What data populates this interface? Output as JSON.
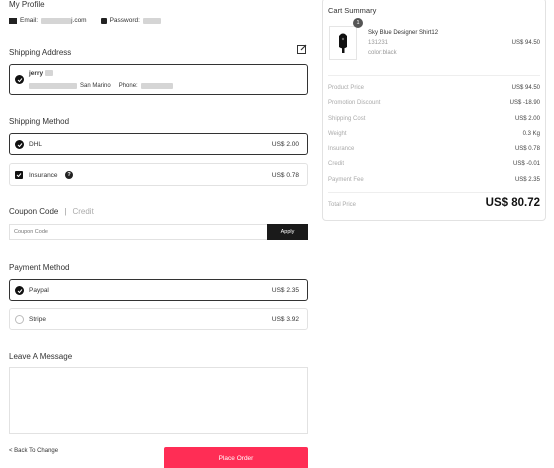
{
  "profile": {
    "title": "My Profile",
    "email_label": "Email:",
    "email_suffix": "j.com",
    "password_label": "Password:"
  },
  "shipping_address": {
    "title": "Shipping Address",
    "name": "jerry",
    "city": "San Marino",
    "phone_label": "Phone:"
  },
  "shipping_method": {
    "title": "Shipping Method",
    "options": [
      {
        "label": "DHL",
        "price": "US$ 2.00",
        "selected": true
      }
    ],
    "insurance_label": "Insurance",
    "insurance_price": "US$ 0.78"
  },
  "coupon": {
    "title": "Coupon Code",
    "divider": "|",
    "credit_tab": "Credit",
    "placeholder": "Coupon Code",
    "apply_label": "Apply"
  },
  "payment_method": {
    "title": "Payment Method",
    "options": [
      {
        "label": "Paypal",
        "price": "US$ 2.35",
        "selected": true
      },
      {
        "label": "Stripe",
        "price": "US$ 3.92",
        "selected": false
      }
    ]
  },
  "message": {
    "title": "Leave A Message"
  },
  "footer": {
    "back_label": "< Back To Change",
    "place_order_label": "Place Order"
  },
  "cart": {
    "title": "Cart Summary",
    "item": {
      "qty": "1",
      "name": "Sky Blue Designer Shirt12",
      "sku": "131231",
      "color": "color:black",
      "price": "US$ 94.50"
    },
    "rows": [
      {
        "key": "Product Price",
        "value": "US$ 94.50"
      },
      {
        "key": "Promotion Discount",
        "value": "US$ -18.90"
      },
      {
        "key": "Shipping Cost",
        "value": "US$ 2.00"
      },
      {
        "key": "Weight",
        "value": "0.3 Kg"
      },
      {
        "key": "Insurance",
        "value": "US$ 0.78"
      },
      {
        "key": "Credit",
        "value": "US$ -0.01"
      },
      {
        "key": "Payment Fee",
        "value": "US$ 2.35"
      }
    ],
    "total_label": "Total Price",
    "total_value": "US$ 80.72"
  },
  "colors": {
    "accent": "#ff2d55",
    "dark": "#1a1a1a",
    "border": "#e2e2e2"
  }
}
